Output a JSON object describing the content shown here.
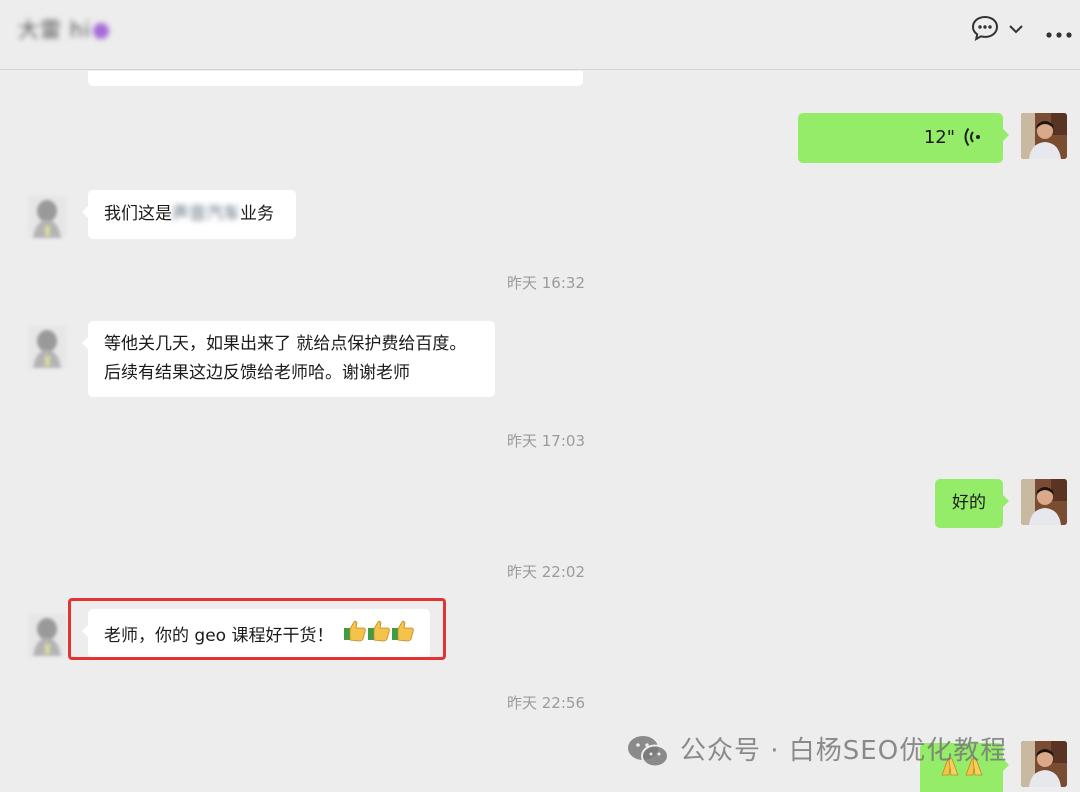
{
  "header": {
    "contact_name": "大雷 hi"
  },
  "messages": [
    {
      "type": "voice_out",
      "duration": "12\""
    },
    {
      "type": "text_in",
      "prefix": "我们这是",
      "obscured": "声音汽车",
      "suffix": "业务"
    },
    {
      "type": "time",
      "text": "昨天 16:32"
    },
    {
      "type": "text_in",
      "line1": "等他关几天，如果出来了 就给点保护费给百度。",
      "line2": "后续有结果这边反馈给老师哈。谢谢老师"
    },
    {
      "type": "time",
      "text": "昨天 17:03"
    },
    {
      "type": "text_out",
      "text": "好的"
    },
    {
      "type": "time",
      "text": "昨天 22:02"
    },
    {
      "type": "text_in",
      "text": "老师，你的 geo 课程好干货！",
      "emoji": "👍👍👍"
    },
    {
      "type": "time",
      "text": "昨天 22:56"
    },
    {
      "type": "emoji_out",
      "emoji": "🙏🙏"
    }
  ],
  "watermark": {
    "text": "公众号 · 白杨SEO优化教程"
  },
  "colors": {
    "bg": "#ededed",
    "bubble_in": "#ffffff",
    "bubble_out": "#95ec69",
    "highlight": "#e23434",
    "timestamp": "#9b9b9b"
  }
}
